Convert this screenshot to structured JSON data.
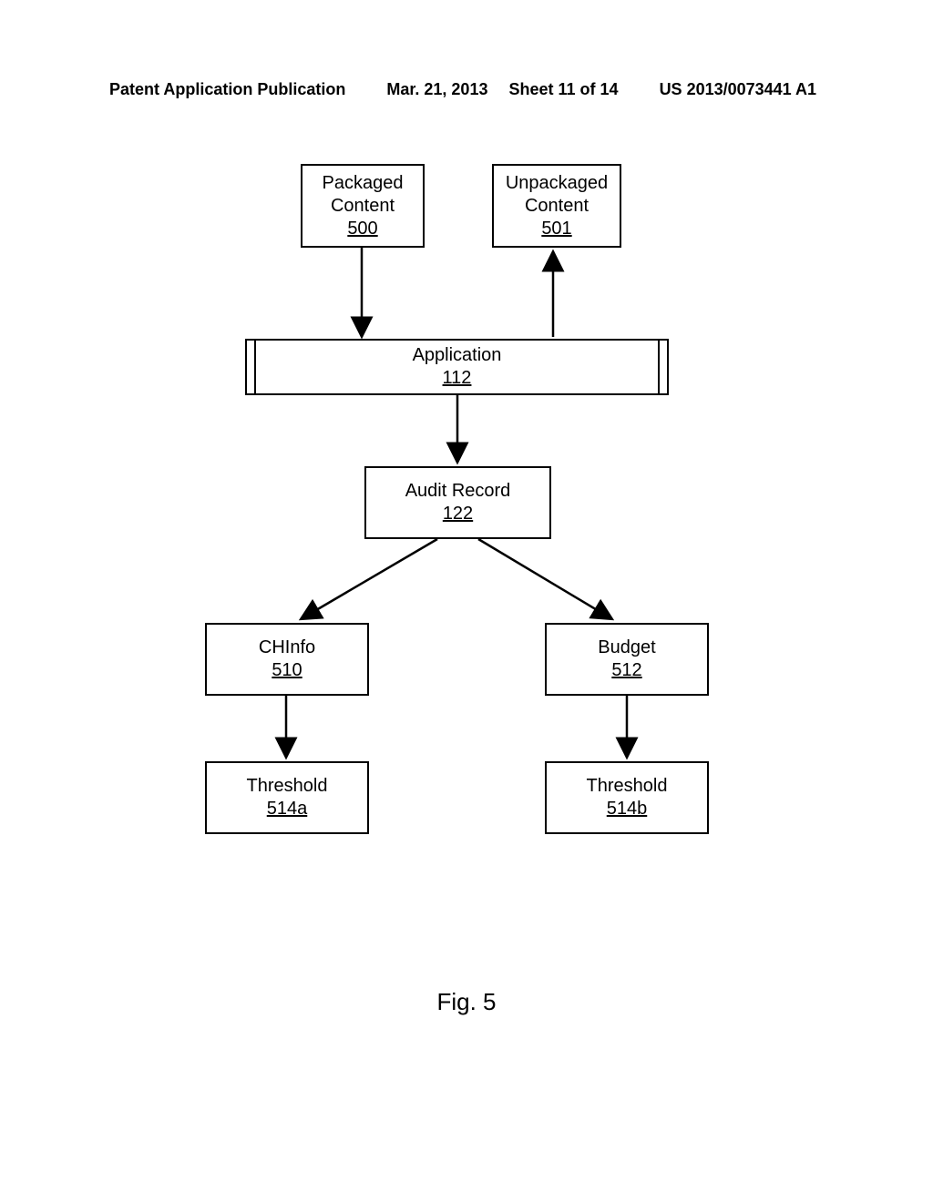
{
  "header": {
    "left": "Patent Application Publication",
    "date": "Mar. 21, 2013",
    "sheet": "Sheet 11 of 14",
    "pub": "US 2013/0073441 A1"
  },
  "boxes": {
    "packaged": {
      "label": "Packaged Content",
      "ref": "500"
    },
    "unpackaged": {
      "label": "Unpackaged Content",
      "ref": "501"
    },
    "application": {
      "label": "Application",
      "ref": "112"
    },
    "audit": {
      "label": "Audit Record",
      "ref": "122"
    },
    "chinfo": {
      "label": "CHInfo",
      "ref": "510"
    },
    "budget": {
      "label": "Budget",
      "ref": "512"
    },
    "threshA": {
      "label": "Threshold",
      "ref": "514a"
    },
    "threshB": {
      "label": "Threshold",
      "ref": "514b"
    }
  },
  "figure": "Fig. 5"
}
